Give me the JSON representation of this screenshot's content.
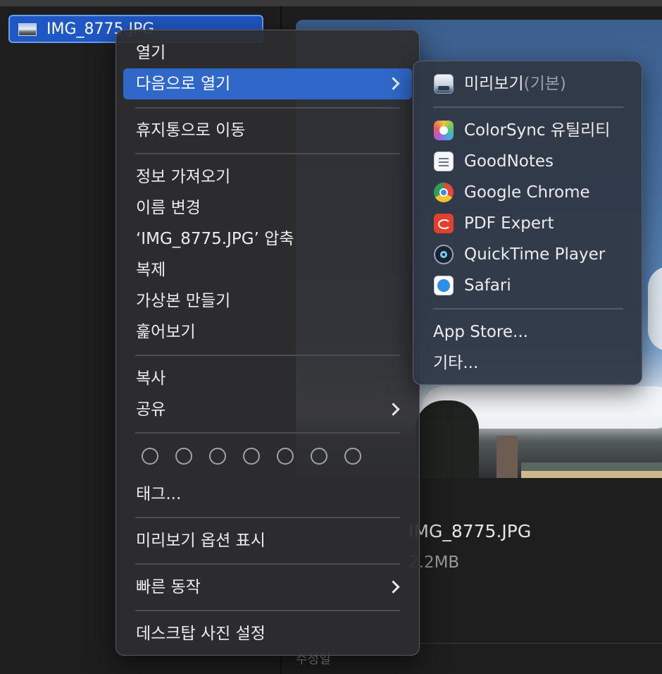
{
  "file": {
    "name": "IMG_8775.JPG"
  },
  "preview": {
    "title": "IMG_8775.JPG",
    "size": "2.2MB",
    "label": "수정일"
  },
  "context_menu": {
    "open": "열기",
    "open_with": "다음으로 열기",
    "move_to_trash": "휴지통으로 이동",
    "get_info": "정보 가져오기",
    "rename": "이름 변경",
    "compress": "‘IMG_8775.JPG’ 압축",
    "duplicate": "복제",
    "make_alias": "가상본 만들기",
    "quick_look": "훑어보기",
    "copy": "복사",
    "share": "공유",
    "tags": "태그...",
    "show_preview_options": "미리보기 옵션 표시",
    "quick_actions": "빠른 동작",
    "set_desktop_picture": "데스크탑 사진 설정"
  },
  "open_with_menu": {
    "default_app": "미리보기",
    "default_suffix": "(기본)",
    "apps": [
      "ColorSync 유틸리티",
      "GoodNotes",
      "Google Chrome",
      "PDF Expert",
      "QuickTime Player",
      "Safari"
    ],
    "app_store": "App Store...",
    "other": "기타..."
  },
  "colors": {
    "highlight": "#2f68c8",
    "selection": "#1f57c4",
    "menu_bg": "#2e2e30",
    "submenu_bg": "#303846"
  },
  "icons": {
    "preview": "preview-app-icon",
    "colorsync": "colorsync-icon",
    "goodnotes": "goodnotes-icon",
    "chrome": "chrome-icon",
    "pdf_expert": "pdf-expert-icon",
    "quicktime": "quicktime-icon",
    "safari": "safari-icon"
  }
}
